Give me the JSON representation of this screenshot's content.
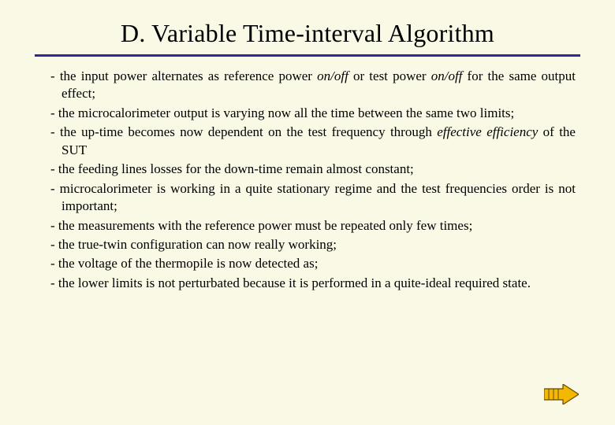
{
  "title": "D. Variable Time-interval Algorithm",
  "items": [
    {
      "pre": "- the input power alternates as reference power ",
      "em1": "on/off",
      "mid": " or test power ",
      "em2": "on/off",
      "post": " for the same output effect;"
    },
    {
      "text": "- the microcalorimeter output is varying now all the time between the same two limits;"
    },
    {
      "pre": "- the up-time becomes now dependent on the test frequency through ",
      "em1": "effective efficiency",
      "post": " of the SUT"
    },
    {
      "text": "- the feeding lines losses for the down-time remain almost constant;"
    },
    {
      "text": "- microcalorimeter is working in a quite stationary regime and the test frequencies order is not important;"
    },
    {
      "text": "- the measurements with the reference power must be repeated only few times;"
    },
    {
      "text": "- the true-twin configuration can now really working;"
    },
    {
      "text": "- the voltage of the thermopile is now detected as;"
    },
    {
      "text": "- the lower limits is not perturbated because it is performed in a quite-ideal required state."
    }
  ],
  "arrow_color": "#f2b900",
  "arrow_stroke": "#6a4a00"
}
